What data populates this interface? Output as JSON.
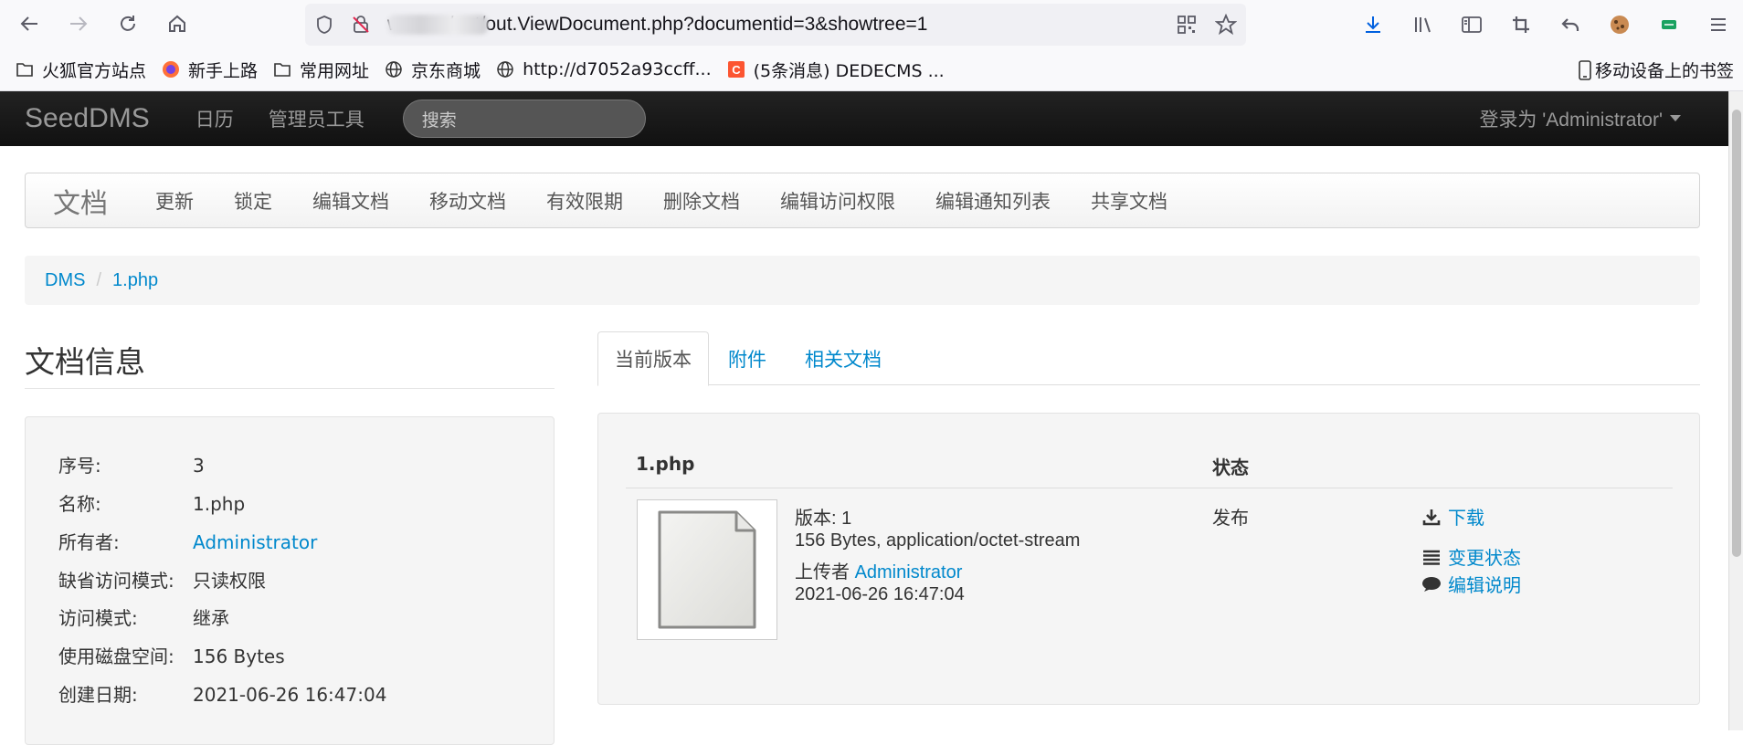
{
  "browser": {
    "url": "w                  .com/out/out.ViewDocument.php?documentid=3&showtree=1",
    "bookmarks": [
      {
        "label": "火狐官方站点",
        "icon": "folder-icon"
      },
      {
        "label": "新手上路",
        "icon": "firefox-icon"
      },
      {
        "label": "常用网址",
        "icon": "folder-icon"
      },
      {
        "label": "京东商城",
        "icon": "globe-icon"
      },
      {
        "label": "http://d7052a93ccff...",
        "icon": "globe-icon"
      },
      {
        "label": "(5条消息) DEDECMS ...",
        "icon": "csdn-icon"
      }
    ],
    "mobile_bookmarks": "移动设备上的书签"
  },
  "navbar": {
    "brand": "SeedDMS",
    "links": [
      "日历",
      "管理员工具"
    ],
    "search_placeholder": "搜索",
    "login_label": "登录为 'Administrator'"
  },
  "subnav": {
    "title": "文档",
    "items": [
      "更新",
      "锁定",
      "编辑文档",
      "移动文档",
      "有效限期",
      "删除文档",
      "编辑访问权限",
      "编辑通知列表",
      "共享文档"
    ]
  },
  "breadcrumb": [
    "DMS",
    "1.php"
  ],
  "doc_info": {
    "title": "文档信息",
    "rows": [
      {
        "key": "序号:",
        "value": "3"
      },
      {
        "key": "名称:",
        "value": "1.php"
      },
      {
        "key": "所有者:",
        "value": "Administrator"
      },
      {
        "key": "缺省访问模式:",
        "value": "只读权限"
      },
      {
        "key": "访问模式:",
        "value": "继承"
      },
      {
        "key": "使用磁盘空间:",
        "value": "156 Bytes"
      },
      {
        "key": "创建日期:",
        "value": "2021-06-26 16:47:04"
      }
    ]
  },
  "tabs": [
    "当前版本",
    "附件",
    "相关文档"
  ],
  "version": {
    "file_header": "1.php",
    "status_header": "状态",
    "version_line": "版本: 1",
    "size_line": "156 Bytes, application/octet-stream",
    "uploader_prefix": "上传者",
    "uploader": "Administrator",
    "date": "2021-06-26 16:47:04",
    "status": "发布",
    "actions": [
      {
        "label": "下载",
        "icon": "download-icon"
      },
      {
        "label": "变更状态",
        "icon": "list-icon"
      },
      {
        "label": "编辑说明",
        "icon": "comment-icon"
      }
    ]
  }
}
